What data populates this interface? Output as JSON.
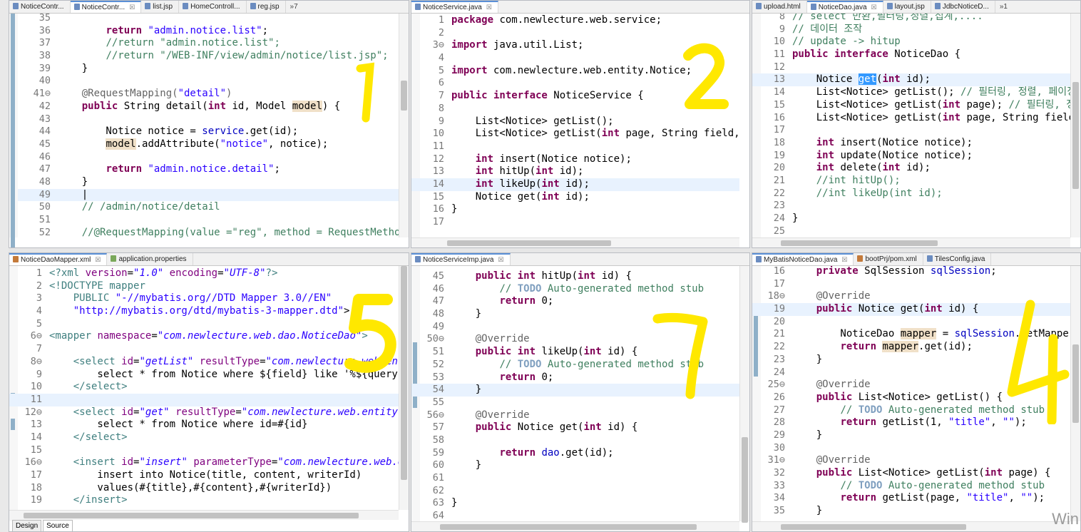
{
  "panes": [
    {
      "id": "p1",
      "tabs": [
        {
          "label": "NoticeContr...",
          "active": false
        },
        {
          "label": "NoticeContr...",
          "active": true,
          "closable": true
        },
        {
          "label": "list.jsp",
          "active": false
        },
        {
          "label": "HomeControll...",
          "active": false
        },
        {
          "label": "reg.jsp",
          "active": false
        }
      ],
      "more": "»7",
      "lines": [
        {
          "n": "35",
          "h": ""
        },
        {
          "n": "36",
          "h": "        <span class=\"kw\">return</span> <span class=\"str\">\"admin.notice.list\"</span>;"
        },
        {
          "n": "37",
          "h": "        <span class=\"cm\">//return \"admin.notice.list\";</span>"
        },
        {
          "n": "38",
          "h": "        <span class=\"cm\">//return \"/WEB-INF/view/admin/notice/list.jsp\";</span>"
        },
        {
          "n": "39",
          "h": "    }"
        },
        {
          "n": "40",
          "h": ""
        },
        {
          "n": "41⊖",
          "h": "    <span class=\"ann\">@RequestMapping(</span><span class=\"str\">\"detail\"</span><span class=\"ann\">)</span>"
        },
        {
          "n": "42",
          "h": "    <span class=\"kw\">public</span> String detail(<span class=\"kw\">int</span> id, Model <span class=\"occ\">model</span>) {"
        },
        {
          "n": "43",
          "h": ""
        },
        {
          "n": "44",
          "h": "        Notice notice = <span class=\"fld\">service</span>.get(id);"
        },
        {
          "n": "45",
          "h": "        <span class=\"occ\">model</span>.addAttribute(<span class=\"str\">\"notice\"</span>, notice);"
        },
        {
          "n": "46",
          "h": ""
        },
        {
          "n": "47",
          "h": "        <span class=\"kw\">return</span> <span class=\"str\">\"admin.notice.detail\"</span>;"
        },
        {
          "n": "48",
          "h": "    }"
        },
        {
          "n": "49",
          "h": "    |",
          "hl": true
        },
        {
          "n": "50",
          "h": "    <span class=\"cm\">// /admin/notice/detail</span>"
        },
        {
          "n": "51",
          "h": ""
        },
        {
          "n": "52",
          "h": "    <span class=\"cm\">//@RequestMapping(value =\"reg\", method = RequestMethod.GE</span>"
        }
      ]
    },
    {
      "id": "p2",
      "tabs": [
        {
          "label": "NoticeService.java",
          "active": true,
          "closable": true
        }
      ],
      "more": "",
      "lines": [
        {
          "n": "1",
          "h": "<span class=\"kw\">package</span> com.newlecture.web.service;"
        },
        {
          "n": "2",
          "h": ""
        },
        {
          "n": "3⊖",
          "h": "<span class=\"kw\">import</span> java.util.List;"
        },
        {
          "n": "4",
          "h": ""
        },
        {
          "n": "5",
          "h": "<span class=\"kw\">import</span> com.newlecture.web.entity.Notice;"
        },
        {
          "n": "6",
          "h": ""
        },
        {
          "n": "7",
          "h": "<span class=\"kw\">public interface</span> NoticeService {"
        },
        {
          "n": "8",
          "h": ""
        },
        {
          "n": "9",
          "h": "    List&lt;Notice&gt; getList();"
        },
        {
          "n": "10",
          "h": "    List&lt;Notice&gt; getList(<span class=\"kw\">int</span> page, String field, Str"
        },
        {
          "n": "11",
          "h": ""
        },
        {
          "n": "12",
          "h": "    <span class=\"kw\">int</span> insert(Notice notice);"
        },
        {
          "n": "13",
          "h": "    <span class=\"kw\">int</span> hitUp(<span class=\"kw\">int</span> id);"
        },
        {
          "n": "14",
          "h": "    <span class=\"kw\">int</span> likeUp(<span class=\"kw\">int</span> id);",
          "hl": true
        },
        {
          "n": "15",
          "h": "    Notice get(<span class=\"kw\">int</span> id);"
        },
        {
          "n": "16",
          "h": "}"
        },
        {
          "n": "17",
          "h": ""
        }
      ]
    },
    {
      "id": "p3",
      "tabs": [
        {
          "label": "upload.html",
          "active": false
        },
        {
          "label": "NoticeDao.java",
          "active": true,
          "closable": true
        },
        {
          "label": "layout.jsp",
          "active": false
        },
        {
          "label": "JdbcNoticeD...",
          "active": false
        }
      ],
      "more": "»1",
      "lines": [
        {
          "n": "8",
          "h": "<span class=\"cm\">// select 반환,필터링,정렬,집계,....</span>"
        },
        {
          "n": "9",
          "h": "<span class=\"cm\">// 데이터 조작</span>"
        },
        {
          "n": "10",
          "h": "<span class=\"cm\">// update -&gt; hitup</span>"
        },
        {
          "n": "11",
          "h": "<span class=\"kw\">public interface</span> NoticeDao {"
        },
        {
          "n": "12",
          "h": ""
        },
        {
          "n": "13",
          "h": "    Notice <span class=\"sel\">get</span>(<span class=\"kw\">int</span> id);",
          "hl": true
        },
        {
          "n": "14",
          "h": "    List&lt;Notice&gt; getList(); <span class=\"cm\">// 필터링, 정렬, 페이징, 집</span>"
        },
        {
          "n": "15",
          "h": "    List&lt;Notice&gt; getList(<span class=\"kw\">int</span> page); <span class=\"cm\">// 필터링, 정렬,</span>"
        },
        {
          "n": "16",
          "h": "    List&lt;Notice&gt; getList(<span class=\"kw\">int</span> page, String field, S"
        },
        {
          "n": "17",
          "h": ""
        },
        {
          "n": "18",
          "h": "    <span class=\"kw\">int</span> insert(Notice notice);"
        },
        {
          "n": "19",
          "h": "    <span class=\"kw\">int</span> update(Notice notice);"
        },
        {
          "n": "20",
          "h": "    <span class=\"kw\">int</span> delete(<span class=\"kw\">int</span> id);"
        },
        {
          "n": "21",
          "h": "    <span class=\"cm\">//int hitUp();</span>"
        },
        {
          "n": "22",
          "h": "    <span class=\"cm\">//int likeUp(int id);</span>"
        },
        {
          "n": "23",
          "h": ""
        },
        {
          "n": "24",
          "h": "}"
        },
        {
          "n": "25",
          "h": ""
        }
      ]
    },
    {
      "id": "p4",
      "tabs": [
        {
          "label": "NoticeDaoMapper.xml",
          "active": true,
          "closable": true,
          "icon": "x"
        },
        {
          "label": "application.properties",
          "active": false,
          "icon": "p"
        }
      ],
      "more": "",
      "lines": [
        {
          "n": "1",
          "h": "<span class=\"tag\">&lt;?xml</span> <span class=\"attr\">version</span>=<span class=\"aval\">\"1.0\"</span> <span class=\"attr\">encoding</span>=<span class=\"aval\">\"UTF-8\"</span><span class=\"tag\">?&gt;</span>"
        },
        {
          "n": "2",
          "h": "<span class=\"tag\">&lt;!DOCTYPE</span> <span class=\"tag\">mapper</span>"
        },
        {
          "n": "3",
          "h": "    <span class=\"tag\">PUBLIC</span> <span class=\"str\">\"-//mybatis.org//DTD Mapper 3.0//EN\"</span>"
        },
        {
          "n": "4",
          "h": "    <span class=\"str\">\"http://mybatis.org/dtd/mybatis-3-mapper.dtd\"</span>&gt;"
        },
        {
          "n": "5",
          "h": ""
        },
        {
          "n": "6⊖",
          "h": "<span class=\"tag\">&lt;mapper</span> <span class=\"attr\">namespace</span>=<span class=\"aval\">\"com.newlecture.web.dao.NoticeDao\"</span><span class=\"tag\">&gt;</span>"
        },
        {
          "n": "7",
          "h": ""
        },
        {
          "n": "8⊖",
          "h": "    <span class=\"tag\">&lt;select</span> <span class=\"attr\">id</span>=<span class=\"aval\">\"getList\"</span> <span class=\"attr\">resultType</span>=<span class=\"aval\">\"com.newlecture.web.entity</span>"
        },
        {
          "n": "9",
          "h": "        select * from Notice where ${field} like '%${query}%'"
        },
        {
          "n": "10",
          "h": "    <span class=\"tag\">&lt;/select&gt;</span>"
        },
        {
          "n": "11",
          "h": "",
          "hl": true
        },
        {
          "n": "12⊖",
          "h": "    <span class=\"tag\">&lt;select</span> <span class=\"attr\">id</span>=<span class=\"aval\">\"get\"</span> <span class=\"attr\">resultType</span>=<span class=\"aval\">\"com.newlecture.web.entity.Not</span>"
        },
        {
          "n": "13",
          "h": "        select * from Notice where id=#{id}"
        },
        {
          "n": "14",
          "h": "    <span class=\"tag\">&lt;/select&gt;</span>"
        },
        {
          "n": "15",
          "h": ""
        },
        {
          "n": "16⊖",
          "h": "    <span class=\"tag\">&lt;insert</span> <span class=\"attr\">id</span>=<span class=\"aval\">\"insert\"</span> <span class=\"attr\">parameterType</span>=<span class=\"aval\">\"com.newlecture.web.enti</span>"
        },
        {
          "n": "17",
          "h": "        insert into Notice(title, content, writerId)"
        },
        {
          "n": "18",
          "h": "        values(#{title},#{content},#{writerId})"
        },
        {
          "n": "19",
          "h": "    <span class=\"tag\">&lt;/insert&gt;</span>"
        }
      ],
      "bottom_tabs": [
        "Design",
        "Source"
      ]
    },
    {
      "id": "p5",
      "tabs": [
        {
          "label": "NoticeServiceImp.java",
          "active": true,
          "closable": true
        }
      ],
      "more": "",
      "lines": [
        {
          "n": "45",
          "h": "    <span class=\"kw\">public int</span> hitUp(<span class=\"kw\">int</span> id) {"
        },
        {
          "n": "46",
          "h": "        <span class=\"cm\">// <span class=\"todo\">TODO</span> Auto-generated method stub</span>"
        },
        {
          "n": "47",
          "h": "        <span class=\"kw\">return</span> 0;"
        },
        {
          "n": "48",
          "h": "    }"
        },
        {
          "n": "49",
          "h": ""
        },
        {
          "n": "50⊖",
          "h": "    <span class=\"ann\">@Override</span>"
        },
        {
          "n": "51",
          "h": "    <span class=\"kw\">public int</span> likeUp(<span class=\"kw\">int</span> id) {"
        },
        {
          "n": "52",
          "h": "        <span class=\"cm\">// <span class=\"todo\">TODO</span> Auto-generated method stub</span>"
        },
        {
          "n": "53",
          "h": "        <span class=\"kw\">return</span> 0;"
        },
        {
          "n": "54",
          "h": "    }",
          "hl": true
        },
        {
          "n": "55",
          "h": ""
        },
        {
          "n": "56⊖",
          "h": "    <span class=\"ann\">@Override</span>"
        },
        {
          "n": "57",
          "h": "    <span class=\"kw\">public</span> Notice get(<span class=\"kw\">int</span> id) {"
        },
        {
          "n": "58",
          "h": ""
        },
        {
          "n": "59",
          "h": "        <span class=\"kw\">return</span> <span class=\"fld\">dao</span>.get(id);"
        },
        {
          "n": "60",
          "h": "    }"
        },
        {
          "n": "61",
          "h": ""
        },
        {
          "n": "62",
          "h": ""
        },
        {
          "n": "63",
          "h": "}"
        },
        {
          "n": "64",
          "h": ""
        }
      ]
    },
    {
      "id": "p6",
      "tabs": [
        {
          "label": "MyBatisNoticeDao.java",
          "active": true,
          "closable": true
        },
        {
          "label": "bootPrj/pom.xml",
          "active": false,
          "icon": "x"
        },
        {
          "label": "TilesConfig.java",
          "active": false
        }
      ],
      "more": "",
      "lines": [
        {
          "n": "16",
          "h": "    <span class=\"kw\">private</span> SqlSession <span class=\"fld\">sqlSession</span>;"
        },
        {
          "n": "17",
          "h": ""
        },
        {
          "n": "18⊖",
          "h": "    <span class=\"ann\">@Override</span>"
        },
        {
          "n": "19",
          "h": "    <span class=\"kw\">public</span> Notice get(<span class=\"kw\">int</span> id) {",
          "hl": true
        },
        {
          "n": "20",
          "h": ""
        },
        {
          "n": "21",
          "h": "        NoticeDao <span class=\"occ\">mapper</span> = <span class=\"fld\">sqlSession</span>.getMapper(Notic"
        },
        {
          "n": "22",
          "h": "        <span class=\"kw\">return</span> <span class=\"occ\">mapper</span>.get(id);"
        },
        {
          "n": "23",
          "h": "    }"
        },
        {
          "n": "24",
          "h": ""
        },
        {
          "n": "25⊖",
          "h": "    <span class=\"ann\">@Override</span>"
        },
        {
          "n": "26",
          "h": "    <span class=\"kw\">public</span> List&lt;Notice&gt; getList() {"
        },
        {
          "n": "27",
          "h": "        <span class=\"cm\">// <span class=\"todo\">TODO</span> Auto-generated method stub</span>"
        },
        {
          "n": "28",
          "h": "        <span class=\"kw\">return</span> getList(1, <span class=\"str\">\"title\"</span>, <span class=\"str\">\"\"</span>);"
        },
        {
          "n": "29",
          "h": "    }"
        },
        {
          "n": "30",
          "h": ""
        },
        {
          "n": "31⊖",
          "h": "    <span class=\"ann\">@Override</span>"
        },
        {
          "n": "32",
          "h": "    <span class=\"kw\">public</span> List&lt;Notice&gt; getList(<span class=\"kw\">int</span> page) {"
        },
        {
          "n": "33",
          "h": "        <span class=\"cm\">// <span class=\"todo\">TODO</span> Auto-generated method stub</span>"
        },
        {
          "n": "34",
          "h": "        <span class=\"kw\">return</span> getList(page, <span class=\"str\">\"title\"</span>, <span class=\"str\">\"\"</span>);"
        },
        {
          "n": "35",
          "h": "    }"
        }
      ]
    }
  ],
  "watermark": "Win",
  "annotation_color": "#ffe800"
}
